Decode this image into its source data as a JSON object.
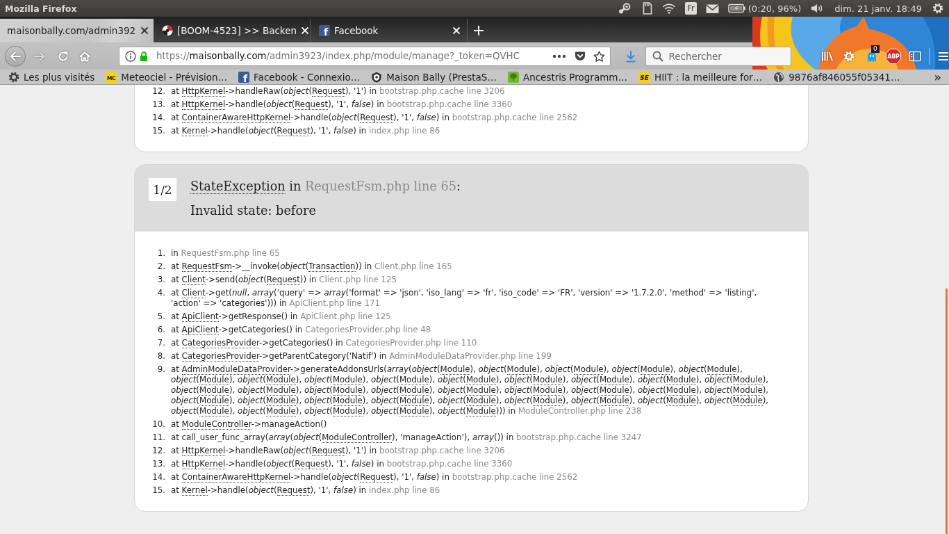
{
  "system_panel": {
    "title": "Mozilla Firefox",
    "keyboard_layout": "Fr",
    "battery_status": "(0:20, 96%)",
    "clock": "dim. 21 janv. 18:49"
  },
  "tabs": [
    {
      "label": "maisonbally.com/admin392",
      "selected": true,
      "kind": "page"
    },
    {
      "label": "[BOOM-4523] >> Backen",
      "selected": false,
      "kind": "tracker"
    },
    {
      "label": "Facebook",
      "selected": false,
      "kind": "social",
      "icon_text": "f"
    }
  ],
  "address_bar": {
    "scheme": "https://",
    "domain": "maisonbally.com",
    "path": "/admin3923/index.php/module/manage?_token=QVHC"
  },
  "search": {
    "placeholder": "Rechercher"
  },
  "toolbar": {
    "extension_badge": "0",
    "blocker_label": "ABP"
  },
  "bookmarks": [
    {
      "label": "Les plus visités",
      "kind": "smart"
    },
    {
      "label": "Meteociel - Prévision…",
      "kind": "weather",
      "icon_text": "MC"
    },
    {
      "label": "Facebook - Connexio…",
      "kind": "social",
      "icon_text": "f"
    },
    {
      "label": "Maison Bally (PrestaS…",
      "kind": "shop"
    },
    {
      "label": "Ancestris Programm…",
      "kind": "software"
    },
    {
      "label": "HIIT : la meilleure for…",
      "kind": "fitness",
      "icon_text": "SE"
    },
    {
      "label": "9876af846055f05341…",
      "kind": "generic"
    }
  ],
  "bookmarks_overflow": "»",
  "previous_exception": {
    "trace": [
      {
        "number": "12.",
        "parts": [
          {
            "kind": "text",
            "text": "at "
          },
          {
            "kind": "class",
            "text": "HttpKernel"
          },
          {
            "kind": "text",
            "text": "->handleRaw(*object*("
          },
          {
            "kind": "class",
            "text": "Request"
          },
          {
            "kind": "text",
            "text": "), '1') in "
          },
          {
            "kind": "file",
            "text": "bootstrap.php.cache line 3206"
          }
        ]
      },
      {
        "number": "13.",
        "parts": [
          {
            "kind": "text",
            "text": "at "
          },
          {
            "kind": "class",
            "text": "HttpKernel"
          },
          {
            "kind": "text",
            "text": "->handle(*object*("
          },
          {
            "kind": "class",
            "text": "Request"
          },
          {
            "kind": "text",
            "text": "), '1', *false*) in "
          },
          {
            "kind": "file",
            "text": "bootstrap.php.cache line 3360"
          }
        ]
      },
      {
        "number": "14.",
        "parts": [
          {
            "kind": "text",
            "text": "at "
          },
          {
            "kind": "class",
            "text": "ContainerAwareHttpKernel"
          },
          {
            "kind": "text",
            "text": "->handle(*object*("
          },
          {
            "kind": "class",
            "text": "Request"
          },
          {
            "kind": "text",
            "text": "), '1', *false*) in "
          },
          {
            "kind": "file",
            "text": "bootstrap.php.cache line 2562"
          }
        ]
      },
      {
        "number": "15.",
        "parts": [
          {
            "kind": "text",
            "text": "at "
          },
          {
            "kind": "class",
            "text": "Kernel"
          },
          {
            "kind": "text",
            "text": "->handle(*object*("
          },
          {
            "kind": "class",
            "text": "Request"
          },
          {
            "kind": "text",
            "text": "), '1', *false*) in "
          },
          {
            "kind": "file",
            "text": "index.php line 86"
          }
        ]
      }
    ]
  },
  "exception": {
    "position": "1/2",
    "title": [
      {
        "kind": "class",
        "text": "StateException"
      },
      {
        "kind": "text",
        "text": " in "
      },
      {
        "kind": "file",
        "text": "RequestFsm.php line 65"
      },
      {
        "kind": "text",
        "text": ":"
      }
    ],
    "message": "Invalid state: before",
    "trace": [
      {
        "number": "1.",
        "parts": [
          {
            "kind": "text",
            "text": "in "
          },
          {
            "kind": "file",
            "text": "RequestFsm.php line 65"
          }
        ]
      },
      {
        "number": "2.",
        "parts": [
          {
            "kind": "text",
            "text": "at "
          },
          {
            "kind": "class",
            "text": "RequestFsm"
          },
          {
            "kind": "text",
            "text": "->__invoke(*object*("
          },
          {
            "kind": "class",
            "text": "Transaction"
          },
          {
            "kind": "text",
            "text": ")) in "
          },
          {
            "kind": "file",
            "text": "Client.php line 165"
          }
        ]
      },
      {
        "number": "3.",
        "parts": [
          {
            "kind": "text",
            "text": "at "
          },
          {
            "kind": "class",
            "text": "Client"
          },
          {
            "kind": "text",
            "text": "->send(*object*("
          },
          {
            "kind": "class",
            "text": "Request"
          },
          {
            "kind": "text",
            "text": ")) in "
          },
          {
            "kind": "file",
            "text": "Client.php line 125"
          }
        ]
      },
      {
        "number": "4.",
        "parts": [
          {
            "kind": "text",
            "text": "at "
          },
          {
            "kind": "class",
            "text": "Client"
          },
          {
            "kind": "text",
            "text": "->get(*null*, *array*('query' => *array*('format' => 'json', 'iso_lang' => 'fr', 'iso_code' => 'FR', 'version' => '1.7.2.0', 'method' => 'listing', 'action' => 'categories'))) in "
          },
          {
            "kind": "file",
            "text": "ApiClient.php line 171"
          }
        ]
      },
      {
        "number": "5.",
        "parts": [
          {
            "kind": "text",
            "text": "at "
          },
          {
            "kind": "class",
            "text": "ApiClient"
          },
          {
            "kind": "text",
            "text": "->getResponse() in "
          },
          {
            "kind": "file",
            "text": "ApiClient.php line 125"
          }
        ]
      },
      {
        "number": "6.",
        "parts": [
          {
            "kind": "text",
            "text": "at "
          },
          {
            "kind": "class",
            "text": "ApiClient"
          },
          {
            "kind": "text",
            "text": "->getCategories() in "
          },
          {
            "kind": "file",
            "text": "CategoriesProvider.php line 48"
          }
        ]
      },
      {
        "number": "7.",
        "parts": [
          {
            "kind": "text",
            "text": "at "
          },
          {
            "kind": "class",
            "text": "CategoriesProvider"
          },
          {
            "kind": "text",
            "text": "->getCategories() in "
          },
          {
            "kind": "file",
            "text": "CategoriesProvider.php line 110"
          }
        ]
      },
      {
        "number": "8.",
        "parts": [
          {
            "kind": "text",
            "text": "at "
          },
          {
            "kind": "class",
            "text": "CategoriesProvider"
          },
          {
            "kind": "text",
            "text": "->getParentCategory('Natif') in "
          },
          {
            "kind": "file",
            "text": "AdminModuleDataProvider.php line 199"
          }
        ]
      },
      {
        "number": "9.",
        "parts": [
          {
            "kind": "text",
            "text": "at "
          },
          {
            "kind": "class",
            "text": "AdminModuleDataProvider"
          },
          {
            "kind": "text",
            "text": "->generateAddonsUrls(*array*(*object*("
          },
          {
            "kind": "class",
            "text": "Module"
          },
          {
            "kind": "text",
            "text": "), *object*("
          },
          {
            "kind": "class",
            "text": "Module"
          },
          {
            "kind": "text",
            "text": "), *object*("
          },
          {
            "kind": "class",
            "text": "Module"
          },
          {
            "kind": "text",
            "text": "), *object*("
          },
          {
            "kind": "class",
            "text": "Module"
          },
          {
            "kind": "text",
            "text": "), *object*("
          },
          {
            "kind": "class",
            "text": "Module"
          },
          {
            "kind": "text",
            "text": "), *object*("
          },
          {
            "kind": "class",
            "text": "Module"
          },
          {
            "kind": "text",
            "text": "), *object*("
          },
          {
            "kind": "class",
            "text": "Module"
          },
          {
            "kind": "text",
            "text": "), *object*("
          },
          {
            "kind": "class",
            "text": "Module"
          },
          {
            "kind": "text",
            "text": "), *object*("
          },
          {
            "kind": "class",
            "text": "Module"
          },
          {
            "kind": "text",
            "text": "), *object*("
          },
          {
            "kind": "class",
            "text": "Module"
          },
          {
            "kind": "text",
            "text": "), *object*("
          },
          {
            "kind": "class",
            "text": "Module"
          },
          {
            "kind": "text",
            "text": "), *object*("
          },
          {
            "kind": "class",
            "text": "Module"
          },
          {
            "kind": "text",
            "text": "), *object*("
          },
          {
            "kind": "class",
            "text": "Module"
          },
          {
            "kind": "text",
            "text": "), *object*("
          },
          {
            "kind": "class",
            "text": "Module"
          },
          {
            "kind": "text",
            "text": "), *object*("
          },
          {
            "kind": "class",
            "text": "Module"
          },
          {
            "kind": "text",
            "text": "), *object*("
          },
          {
            "kind": "class",
            "text": "Module"
          },
          {
            "kind": "text",
            "text": "), *object*("
          },
          {
            "kind": "class",
            "text": "Module"
          },
          {
            "kind": "text",
            "text": "), *object*("
          },
          {
            "kind": "class",
            "text": "Module"
          },
          {
            "kind": "text",
            "text": "), *object*("
          },
          {
            "kind": "class",
            "text": "Module"
          },
          {
            "kind": "text",
            "text": "), *object*("
          },
          {
            "kind": "class",
            "text": "Module"
          },
          {
            "kind": "text",
            "text": "), *object*("
          },
          {
            "kind": "class",
            "text": "Module"
          },
          {
            "kind": "text",
            "text": "), *object*("
          },
          {
            "kind": "class",
            "text": "Module"
          },
          {
            "kind": "text",
            "text": "), *object*("
          },
          {
            "kind": "class",
            "text": "Module"
          },
          {
            "kind": "text",
            "text": "), *object*("
          },
          {
            "kind": "class",
            "text": "Module"
          },
          {
            "kind": "text",
            "text": "), *object*("
          },
          {
            "kind": "class",
            "text": "Module"
          },
          {
            "kind": "text",
            "text": "), *object*("
          },
          {
            "kind": "class",
            "text": "Module"
          },
          {
            "kind": "text",
            "text": "), *object*("
          },
          {
            "kind": "class",
            "text": "Module"
          },
          {
            "kind": "text",
            "text": "), *object*("
          },
          {
            "kind": "class",
            "text": "Module"
          },
          {
            "kind": "text",
            "text": "), *object*("
          },
          {
            "kind": "class",
            "text": "Module"
          },
          {
            "kind": "text",
            "text": "), *object*("
          },
          {
            "kind": "class",
            "text": "Module"
          },
          {
            "kind": "text",
            "text": "), *object*("
          },
          {
            "kind": "class",
            "text": "Module"
          },
          {
            "kind": "text",
            "text": "), *object*("
          },
          {
            "kind": "class",
            "text": "Module"
          },
          {
            "kind": "text",
            "text": "), *object*("
          },
          {
            "kind": "class",
            "text": "Module"
          },
          {
            "kind": "text",
            "text": "), *object*("
          },
          {
            "kind": "class",
            "text": "Module"
          },
          {
            "kind": "text",
            "text": "), *object*("
          },
          {
            "kind": "class",
            "text": "Module"
          },
          {
            "kind": "text",
            "text": "), *object*("
          },
          {
            "kind": "class",
            "text": "Module"
          },
          {
            "kind": "text",
            "text": "), *object*("
          },
          {
            "kind": "class",
            "text": "Module"
          },
          {
            "kind": "text",
            "text": "))) in "
          },
          {
            "kind": "file",
            "text": "ModuleController.php line 238"
          }
        ]
      },
      {
        "number": "10.",
        "parts": [
          {
            "kind": "text",
            "text": "at "
          },
          {
            "kind": "class",
            "text": "ModuleController"
          },
          {
            "kind": "text",
            "text": "->manageAction()"
          }
        ]
      },
      {
        "number": "11.",
        "parts": [
          {
            "kind": "text",
            "text": "at call_user_func_array(*array*(*object*("
          },
          {
            "kind": "class",
            "text": "ModuleController"
          },
          {
            "kind": "text",
            "text": "), 'manageAction'), *array*()) in "
          },
          {
            "kind": "file",
            "text": "bootstrap.php.cache line 3247"
          }
        ]
      },
      {
        "number": "12.",
        "parts": [
          {
            "kind": "text",
            "text": "at "
          },
          {
            "kind": "class",
            "text": "HttpKernel"
          },
          {
            "kind": "text",
            "text": "->handleRaw(*object*("
          },
          {
            "kind": "class",
            "text": "Request"
          },
          {
            "kind": "text",
            "text": "), '1') in "
          },
          {
            "kind": "file",
            "text": "bootstrap.php.cache line 3206"
          }
        ]
      },
      {
        "number": "13.",
        "parts": [
          {
            "kind": "text",
            "text": "at "
          },
          {
            "kind": "class",
            "text": "HttpKernel"
          },
          {
            "kind": "text",
            "text": "->handle(*object*("
          },
          {
            "kind": "class",
            "text": "Request"
          },
          {
            "kind": "text",
            "text": "), '1', *false*) in "
          },
          {
            "kind": "file",
            "text": "bootstrap.php.cache line 3360"
          }
        ]
      },
      {
        "number": "14.",
        "parts": [
          {
            "kind": "text",
            "text": "at "
          },
          {
            "kind": "class",
            "text": "ContainerAwareHttpKernel"
          },
          {
            "kind": "text",
            "text": "->handle(*object*("
          },
          {
            "kind": "class",
            "text": "Request"
          },
          {
            "kind": "text",
            "text": "), '1', *false*) in "
          },
          {
            "kind": "file",
            "text": "bootstrap.php.cache line 2562"
          }
        ]
      },
      {
        "number": "15.",
        "parts": [
          {
            "kind": "text",
            "text": "at "
          },
          {
            "kind": "class",
            "text": "Kernel"
          },
          {
            "kind": "text",
            "text": "->handle(*object*("
          },
          {
            "kind": "class",
            "text": "Request"
          },
          {
            "kind": "text",
            "text": "), '1', *false*) in "
          },
          {
            "kind": "file",
            "text": "index.php line 86"
          }
        ]
      }
    ]
  }
}
